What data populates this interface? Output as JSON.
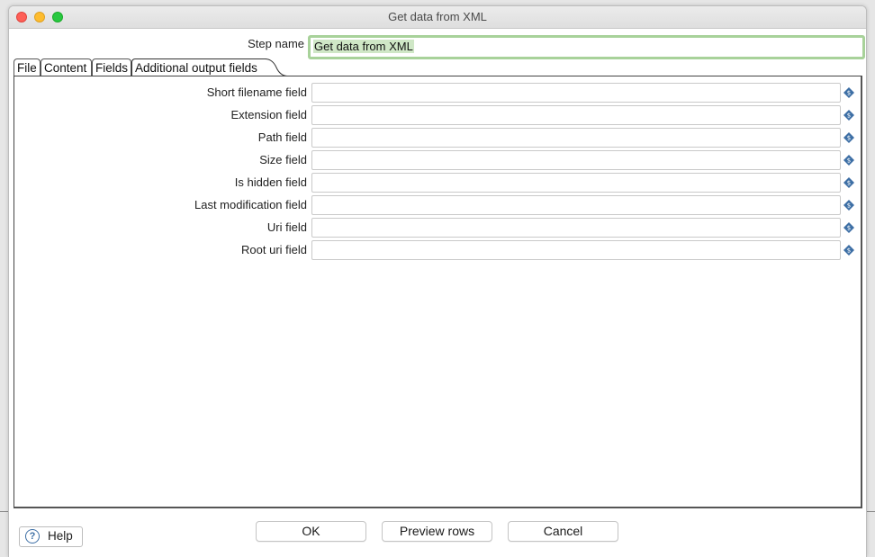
{
  "window": {
    "title": "Get data from XML"
  },
  "step": {
    "label": "Step name",
    "value": "Get data from XML"
  },
  "tabs": [
    {
      "label": "File"
    },
    {
      "label": "Content"
    },
    {
      "label": "Fields"
    },
    {
      "label": "Additional output fields",
      "active": true
    }
  ],
  "fields": [
    {
      "label": "Short filename field",
      "value": ""
    },
    {
      "label": "Extension field",
      "value": ""
    },
    {
      "label": "Path field",
      "value": ""
    },
    {
      "label": "Size field",
      "value": ""
    },
    {
      "label": "Is hidden field",
      "value": ""
    },
    {
      "label": "Last modification field",
      "value": ""
    },
    {
      "label": "Uri field",
      "value": ""
    },
    {
      "label": "Root uri field",
      "value": ""
    }
  ],
  "buttons": {
    "help": "Help",
    "ok": "OK",
    "preview": "Preview rows",
    "cancel": "Cancel"
  },
  "icons": {
    "variable": "variable-diamond-icon",
    "help": "question-circle-icon"
  },
  "colors": {
    "focus_ring": "#a8d29a",
    "selection": "#cfe7c6",
    "icon_blue": "#3d6fa5"
  }
}
